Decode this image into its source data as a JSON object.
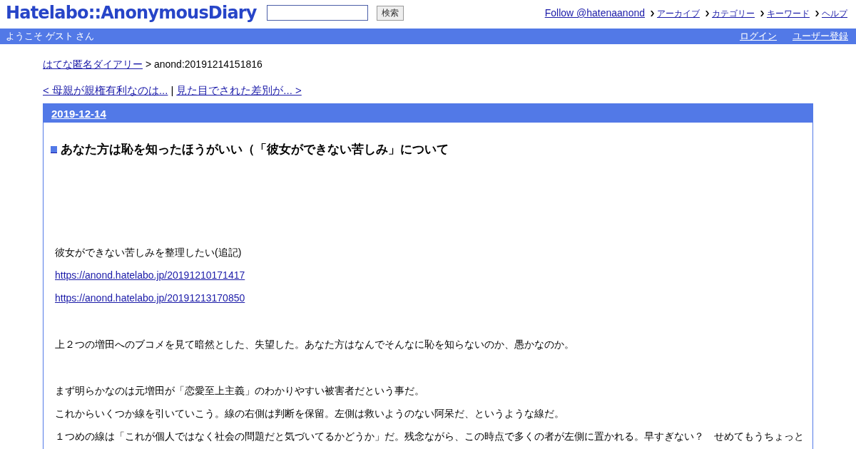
{
  "header": {
    "logo": "Hatelabo::AnonymousDiary",
    "search": {
      "button": "検索"
    },
    "follow": "Follow @hatenaanond",
    "nav": [
      "アーカイブ",
      "カテゴリー",
      "キーワード",
      "ヘルプ"
    ]
  },
  "userbar": {
    "welcome": "ようこそ ゲスト さん",
    "links": [
      "ログイン",
      "ユーザー登録"
    ]
  },
  "breadcrumb": {
    "link": "はてな匿名ダイアリー",
    "current": "> anond:20191214151816"
  },
  "pager": {
    "prev": "< 母親が親権有利なのは...",
    "separator": "|",
    "next": "見た目でされた差別が... >"
  },
  "entry": {
    "date": "2019-12-14",
    "title": "あなた方は恥を知ったほうがいい（「彼女ができない苦しみ」について",
    "blocks": [
      [
        {
          "kind": "text",
          "text": "彼女ができない苦しみを整理したい(追記)"
        },
        {
          "kind": "link",
          "text": "https://anond.hatelabo.jp/20191210171417"
        },
        {
          "kind": "link",
          "text": "https://anond.hatelabo.jp/20191213170850"
        }
      ],
      [
        {
          "kind": "text",
          "text": "上２つの増田へのブコメを見て暗然とした、失望した。あなた方はなんでそんなに恥を知らないのか、愚かなのか。"
        }
      ],
      [
        {
          "kind": "text",
          "text": "まず明らかなのは元増田が「恋愛至上主義」のわかりやすい被害者だという事だ。"
        },
        {
          "kind": "text",
          "text": "これからいくつか線を引いていこう。線の右側は判断を保留。左側は救いようのない阿呆だ、というような線だ。"
        },
        {
          "kind": "text",
          "text": "１つめの線は「これが個人ではなく社会の問題だと気づいてるかどうか」だ。残念ながら、この時点で多くの者が左側に置かれる。早すぎない？　せめてもうちょっと"
        }
      ]
    ]
  }
}
